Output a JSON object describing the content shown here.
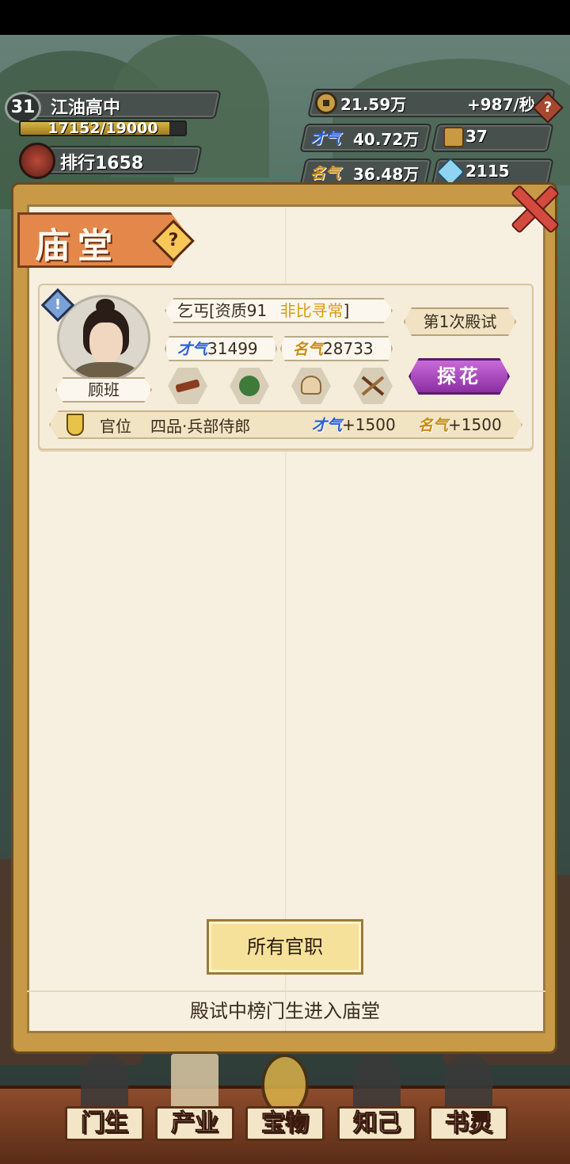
{
  "hud": {
    "level": "31",
    "school": "江油高中",
    "xp_text": "17152/19000",
    "xp_progress": 0.9027,
    "rank_label": "排行1658",
    "money": "21.59万",
    "money_rate": "+987/秒",
    "help": "?",
    "talent_label": "才气",
    "talent_value": "40.72万",
    "fame_label": "名气",
    "fame_value": "36.48万",
    "item_count": "37",
    "gem_count": "2115"
  },
  "panel": {
    "title": "庙堂",
    "help": "?",
    "student": {
      "name": "顾班",
      "alert": "!",
      "qualification_prefix": "乞丐[资质91",
      "qualification_grade": "非比寻常",
      "qualification_suffix": "]",
      "talent_label": "才气",
      "talent_value": "31499",
      "fame_label": "名气",
      "fame_value": "28733",
      "exam_count": "第1次殿试",
      "exam_rank": "探花",
      "post_label": "官位",
      "post_value": "四品·兵部侍郎",
      "post_talent_label": "才气",
      "post_talent_bonus": "+1500",
      "post_fame_label": "名气",
      "post_fame_bonus": "+1500"
    },
    "all_posts_button": "所有官职",
    "footer": "殿试中榜门生进入庙堂"
  },
  "nav": {
    "items": [
      {
        "label": "门生"
      },
      {
        "label": "产业"
      },
      {
        "label": "宝物"
      },
      {
        "label": "知己"
      },
      {
        "label": "书灵"
      }
    ]
  },
  "colors": {
    "banner": "#e4874a",
    "rank_badge": "#b14fc9",
    "gold_text": "#d89a12",
    "purple_text": "#b14fc9"
  }
}
